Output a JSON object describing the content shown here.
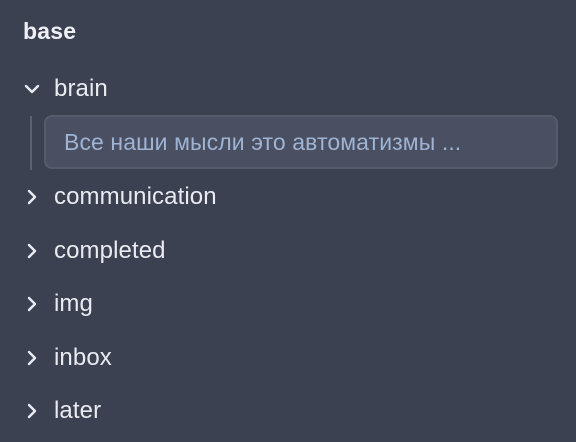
{
  "tree": {
    "root": "base",
    "folders": [
      {
        "label": "brain",
        "expanded": true
      },
      {
        "label": "communication",
        "expanded": false
      },
      {
        "label": "completed",
        "expanded": false
      },
      {
        "label": "img",
        "expanded": false
      },
      {
        "label": "inbox",
        "expanded": false
      },
      {
        "label": "later",
        "expanded": false
      }
    ],
    "brain_children": [
      {
        "label": "Все наши мысли это автоматизмы ..."
      }
    ]
  },
  "colors": {
    "background": "#3b4151",
    "selected_item_background": "#4a5062",
    "selected_item_text": "#9fb3d3",
    "text": "#e9ebf1"
  },
  "icons": {
    "expanded": "chevron-down-icon",
    "collapsed": "chevron-right-icon"
  }
}
